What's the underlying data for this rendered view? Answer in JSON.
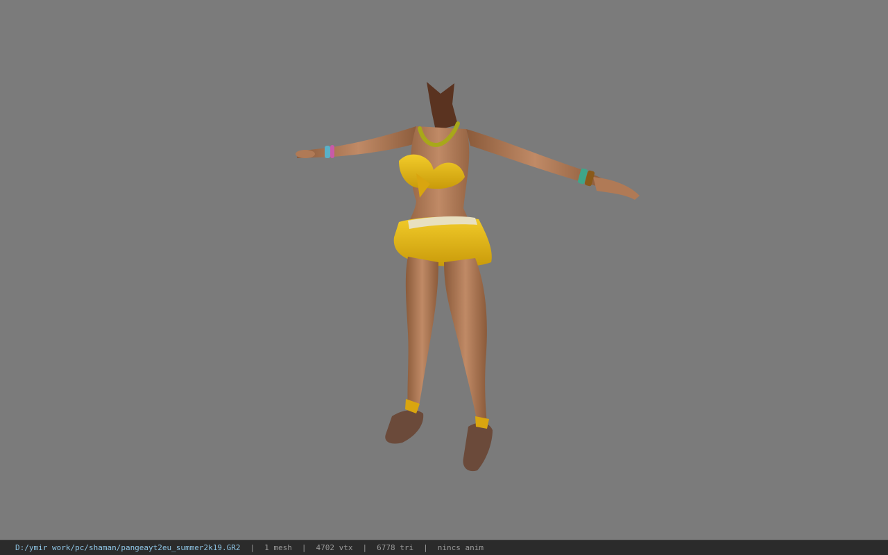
{
  "viewport": {
    "background": "#7b7b7b",
    "model": "headless female character in yellow bikini with ruffled skirt, T-pose"
  },
  "statusbar": {
    "file_path": "D:/ymir work/pc/shaman/pangeayt2eu_summer2k19.GR2",
    "separator": "|",
    "mesh": "1 mesh",
    "vertices": "4702 vtx",
    "triangles": "6778 tri",
    "animation": "nincs anim",
    "path_color": "#8fc6e6",
    "text_color": "#9a9a9a"
  }
}
